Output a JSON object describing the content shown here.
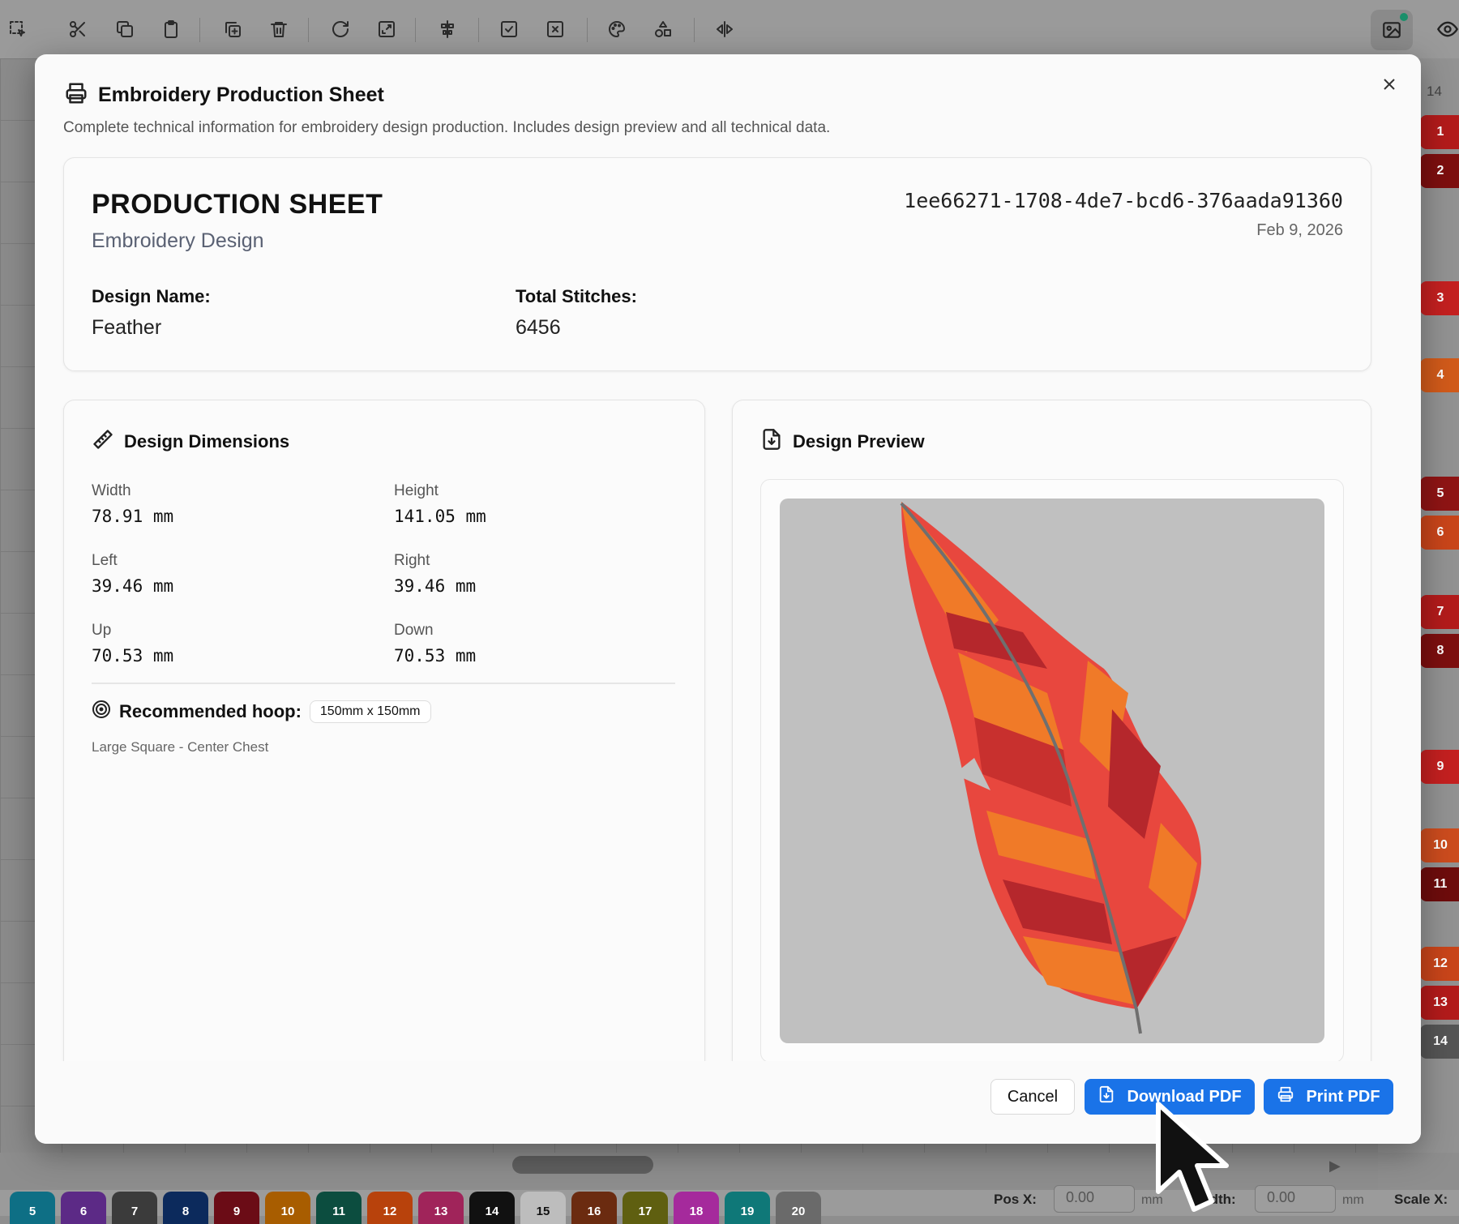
{
  "app": {
    "ruler_top_label": "14",
    "right_swatches": [
      {
        "label": "1",
        "color": "#b31b1b"
      },
      {
        "label": "2",
        "color": "#7d0f0f"
      },
      {
        "label": "3",
        "color": "#c42020"
      },
      {
        "label": "4",
        "color": "#d15a1a"
      },
      {
        "label": "5",
        "color": "#8f1414"
      },
      {
        "label": "6",
        "color": "#c9451a"
      },
      {
        "label": "7",
        "color": "#b31b1b"
      },
      {
        "label": "8",
        "color": "#7d0f0f"
      },
      {
        "label": "9",
        "color": "#c42020"
      },
      {
        "label": "10",
        "color": "#cc4c1e"
      },
      {
        "label": "11",
        "color": "#6e0c0c"
      },
      {
        "label": "12",
        "color": "#c9451a"
      },
      {
        "label": "13",
        "color": "#b31b1b"
      },
      {
        "label": "14",
        "color": "#555555"
      }
    ],
    "bottom_swatches": [
      {
        "label": "5",
        "color": "#0e6f85"
      },
      {
        "label": "6",
        "color": "#5c2a86"
      },
      {
        "label": "7",
        "color": "#3b3b3b"
      },
      {
        "label": "8",
        "color": "#0c2a5c"
      },
      {
        "label": "9",
        "color": "#6b0c16"
      },
      {
        "label": "10",
        "color": "#a85d00"
      },
      {
        "label": "11",
        "color": "#0c4d3f"
      },
      {
        "label": "12",
        "color": "#b8420c"
      },
      {
        "label": "13",
        "color": "#a0245a"
      },
      {
        "label": "14",
        "color": "#111111"
      },
      {
        "label": "15",
        "color": "#bdbdbd"
      },
      {
        "label": "16",
        "color": "#6b2b10"
      },
      {
        "label": "17",
        "color": "#5f5f10"
      },
      {
        "label": "18",
        "color": "#a52a9c"
      },
      {
        "label": "19",
        "color": "#0f7878"
      },
      {
        "label": "20",
        "color": "#6a6a6a"
      }
    ],
    "status": {
      "pos_x_label": "Pos X:",
      "pos_x_value": "0.00",
      "pos_x_unit": "mm",
      "width_label": "Width:",
      "width_value": "0.00",
      "width_unit": "mm",
      "scale_x_label": "Scale X:"
    }
  },
  "modal": {
    "title": "Embroidery Production Sheet",
    "description": "Complete technical information for embroidery design production. Includes design preview and all technical data.",
    "sheet": {
      "heading": "PRODUCTION SHEET",
      "subheading": "Embroidery Design",
      "design_id": "1ee66271-1708-4de7-bcd6-376aada91360",
      "date": "Feb 9, 2026",
      "design_name_label": "Design Name:",
      "design_name": "Feather",
      "total_stitches_label": "Total Stitches:",
      "total_stitches": "6456"
    },
    "dimensions": {
      "title": "Design Dimensions",
      "width_label": "Width",
      "width": "78.91 mm",
      "height_label": "Height",
      "height": "141.05 mm",
      "left_label": "Left",
      "left": "39.46 mm",
      "right_label": "Right",
      "right": "39.46 mm",
      "up_label": "Up",
      "up": "70.53 mm",
      "down_label": "Down",
      "down": "70.53 mm",
      "hoop_label": "Recommended hoop:",
      "hoop_value": "150mm x 150mm",
      "hoop_note": "Large Square - Center Chest"
    },
    "preview": {
      "title": "Design Preview"
    },
    "buttons": {
      "cancel": "Cancel",
      "download": "Download PDF",
      "print": "Print PDF"
    }
  }
}
